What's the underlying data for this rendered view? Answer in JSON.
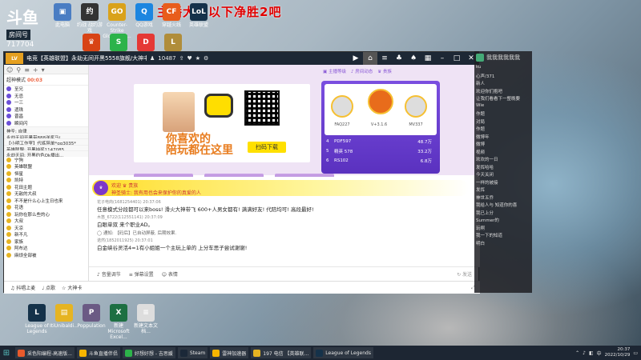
{
  "overlay": {
    "title": "主播大师以下净胜2吧"
  },
  "brand": {
    "logo": "斗鱼",
    "room_label": "房间号",
    "room_id": "717704"
  },
  "desktop_top_icons": [
    {
      "label": "此电脑",
      "color": "#4a7dc3",
      "glyph": "▣"
    },
    {
      "label": "约战 战约游戏",
      "color": "#333333",
      "glyph": "约"
    },
    {
      "label": "Counter-Strike Global Off...",
      "color": "#d9a21b",
      "glyph": "GO"
    },
    {
      "label": "QQ游戏",
      "color": "#1c86e0",
      "glyph": "Q"
    },
    {
      "label": "穿越火线",
      "color": "#e85d1c",
      "glyph": "CF"
    },
    {
      "label": "英雄联盟",
      "color": "#15324a",
      "glyph": "LoL"
    }
  ],
  "desktop_second_icons": [
    {
      "label": "",
      "color": "#d84315",
      "glyph": "♛"
    },
    {
      "label": "",
      "color": "#2cb34a",
      "glyph": "S"
    },
    {
      "label": "",
      "color": "#e53935",
      "glyph": "D"
    },
    {
      "label": "",
      "color": "#b08d3a",
      "glyph": "L"
    }
  ],
  "desktop_bottom_icons": [
    {
      "label": "League of Legends",
      "color": "#15324a",
      "glyph": "L"
    },
    {
      "label": "ItiUnibaldi...",
      "color": "#e6b422",
      "glyph": "▤"
    },
    {
      "label": "Poppulation",
      "color": "#6b5a84",
      "glyph": "P"
    },
    {
      "label": "新建 Microsoft Excel...",
      "color": "#1d6f42",
      "glyph": "X"
    },
    {
      "label": "新建文本文档...",
      "color": "#dddddd",
      "glyph": "≡"
    }
  ],
  "window": {
    "level_badge": "LV",
    "title": "电竞【英雄联盟】永劫无间开黑5558旗舰/大神丰397旗舰",
    "follow": "10487",
    "nav_icons": [
      "video-icon",
      "home-icon",
      "list-icon",
      "gamepad-icon",
      "shirt-icon",
      "grid-icon",
      "minus-icon",
      "maximize-icon",
      "close-icon"
    ]
  },
  "left_panel": {
    "head_label": "超神模式",
    "head_count": "00:03",
    "rows": [
      {
        "name": "至兄",
        "color": "#6b4fd8"
      },
      {
        "name": "无忌",
        "color": "#6b4fd8"
      },
      {
        "name": "一三",
        "color": "#6b4fd8"
      },
      {
        "name": "遗珠",
        "color": "#6b4fd8"
      },
      {
        "name": "晋昌",
        "color": "#6b4fd8"
      },
      {
        "name": "瞬间闪",
        "color": "#6b4fd8"
      }
    ],
    "announcements": [
      "神圣: 自律",
      "永劫无间开黑带888送奖马(",
      "【小明工作室】代练陪单*qq3035*",
      "英雄联盟: 开黑抽奖1147085",
      "永劫无间: 开黑约色Ok播出..."
    ],
    "users": [
      {
        "name": "宁狗",
        "color": "#e6b422"
      },
      {
        "name": "英雄联盟",
        "color": "#e6b422"
      },
      {
        "name": "恒星",
        "color": "#e6b422"
      },
      {
        "name": "凯特",
        "color": "#e6b422"
      },
      {
        "name": "花田主题",
        "color": "#e6b422"
      },
      {
        "name": "无敌的大叔",
        "color": "#e6b422"
      },
      {
        "name": "不不是什么心上生日也来",
        "color": "#e6b422"
      },
      {
        "name": "花语",
        "color": "#e6b422"
      },
      {
        "name": "玩你在那么些的心",
        "color": "#e6b422"
      },
      {
        "name": "大叔",
        "color": "#e6b422"
      },
      {
        "name": "天凉",
        "color": "#e6b422"
      },
      {
        "name": "新不凡",
        "color": "#e6b422"
      },
      {
        "name": "家族",
        "color": "#e6b422"
      },
      {
        "name": "阿布达",
        "color": "#e6b422"
      },
      {
        "name": "麻烦全部被",
        "color": "#e6b422"
      }
    ]
  },
  "banner": {
    "slogan_line1": "你喜欢的",
    "slogan_line2": "陪玩都在这里",
    "download_label": "扫码下载",
    "buttons": [
      "☆ 交友陪玩榜",
      "♡ CP 合作榜",
      "☆ 交友活动榜"
    ],
    "top_nav": [
      "▣ 主播等级",
      "♪ 房间动态",
      "♛ 贵族"
    ],
    "rank_tabs": [
      "贡献榜",
      "亲密榜",
      "粉丝"
    ],
    "rank_top": [
      {
        "name": "FAQ227"
      },
      {
        "name": "V+3.1.6"
      },
      {
        "name": "MV337"
      }
    ],
    "rank_rows": [
      {
        "pos": "4",
        "name": "PDF597",
        "value": "48.7万"
      },
      {
        "pos": "5",
        "name": "精英 578",
        "value": "33.2万"
      },
      {
        "pos": "6",
        "name": "RS102",
        "value": "6.8万"
      }
    ]
  },
  "chat": {
    "welcome_user": "欢迎 ♛ 贵族",
    "welcome_msg": "神圣骑士: 我有用也会来保护你的真爱的人",
    "messages": [
      {
        "meta": "花子电商(1681254401) 20:37:06",
        "text": "任意模式分段都可以来boss! 滑火大神带飞 600+人男女都有! 满满好友! 代陪均可! 高段最好!"
      },
      {
        "meta": "木笛_6722(112551141) 20:37:09",
        "text": "白眼单双 来个职业AD。"
      },
      {
        "meta": "",
        "text": "◯ 通知: 【码后】已自动屏蔽, 后期效果."
      },
      {
        "meta": "诺然(1852011925) 20:37:01",
        "text": "白金峡谷灵活4=1有小姐姐一个主玩上单的 上分车思子尝试谢谢!"
      }
    ],
    "input_items": [
      "♪ 音量调节",
      "≡ 弹幕设置",
      "☺ 表情"
    ],
    "input_right": "↻ 发送"
  },
  "bottom_bar": {
    "items": [
      "♫ 抖唱上麦",
      "♩ 点歌",
      "☆ 大神卡"
    ],
    "right": "⤢"
  },
  "right_panel": {
    "title": "我我我我我我",
    "lines": [
      "ku",
      "心声/371",
      "新人",
      "欢迎你们抱吧",
      "让我们看看下一整晚要",
      "Wie",
      "作题",
      "对局",
      "作题",
      "微博年",
      "微博",
      "视频",
      "欢欢的一日",
      "发挥哈哈",
      "今天关闭",
      "一样的被接",
      "发挥",
      "神世五乔",
      "我给人与 知道你的喜",
      "我已上分",
      "Summer的",
      "玩啊",
      "我一下的知道",
      "明白"
    ]
  },
  "taskbar": {
    "tasks": [
      {
        "label": "采色阳编程-高速版...",
        "color": "#e95a2c"
      },
      {
        "label": "斗鱼直播伴侣",
        "color": "#f7b500"
      },
      {
        "label": "好想好想 - 吉思媛",
        "color": "#2cb34a"
      },
      {
        "label": "Steam",
        "color": "#1b2838"
      },
      {
        "label": "雷神加速器",
        "color": "#f7b500"
      },
      {
        "label": "197 电信 【英雄联...",
        "color": "#e6b422"
      },
      {
        "label": "League of Legends",
        "color": "#15324a"
      }
    ],
    "time": "20:37",
    "date": "2022/10/29",
    "ime": "中"
  }
}
